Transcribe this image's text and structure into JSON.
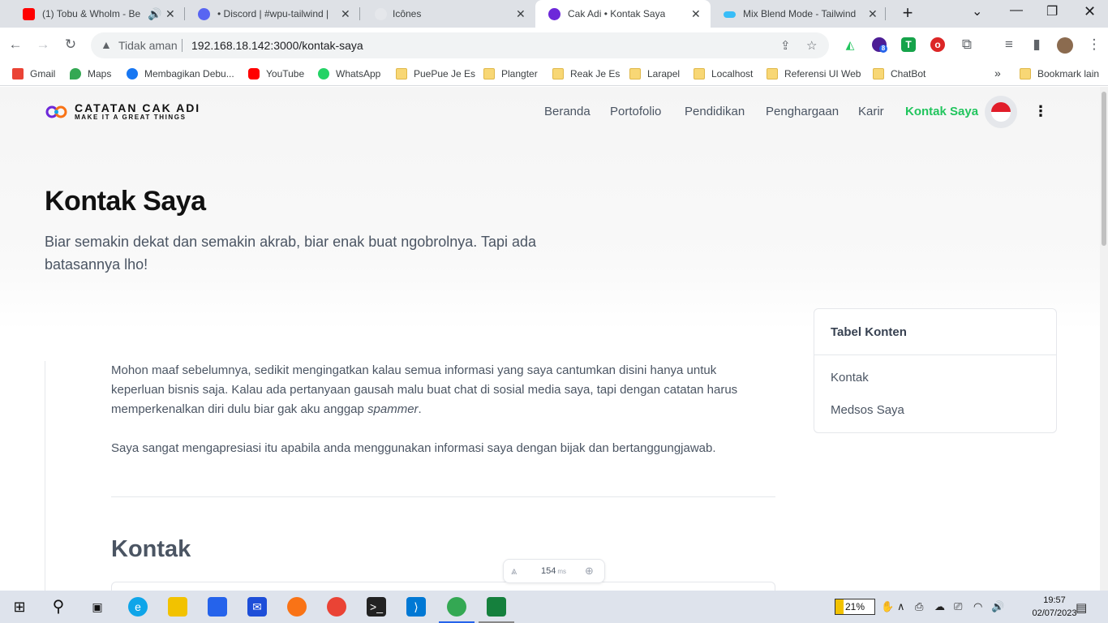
{
  "tabs": [
    {
      "title": "(1) Tobu & Wholm - Be",
      "active": false
    },
    {
      "title": "• Discord | #wpu-tailwind |",
      "active": false
    },
    {
      "title": "Icônes",
      "active": false
    },
    {
      "title": "Cak Adi • Kontak Saya",
      "active": true
    },
    {
      "title": "Mix Blend Mode - Tailwind",
      "active": false
    }
  ],
  "toolbar": {
    "security_label": "Tidak aman",
    "url": "192.168.18.142:3000/kontak-saya",
    "ext_badge": "8"
  },
  "bookmarks": [
    {
      "label": "Gmail"
    },
    {
      "label": "Maps"
    },
    {
      "label": "Membagikan Debu..."
    },
    {
      "label": "YouTube"
    },
    {
      "label": "WhatsApp"
    },
    {
      "label": "PuePue Je Es"
    },
    {
      "label": "Plangter"
    },
    {
      "label": "Reak Je Es"
    },
    {
      "label": "Larapel"
    },
    {
      "label": "Localhost"
    },
    {
      "label": "Referensi UI Web"
    },
    {
      "label": "ChatBot"
    },
    {
      "label": "Bookmark lain"
    }
  ],
  "site": {
    "logo_title": "CATATAN CAK ADI",
    "logo_tagline": "MAKE IT A GREAT THINGS",
    "nav": [
      "Beranda",
      "Portofolio",
      "Pendidikan",
      "Penghargaan",
      "Karir",
      "Kontak Saya"
    ],
    "active_nav": "Kontak Saya",
    "accent": "#22c55e"
  },
  "hero": {
    "title": "Kontak Saya",
    "subtitle": "Biar semakin dekat dan semakin akrab, biar enak buat ngobrolnya. Tapi ada batasannya lho!"
  },
  "article": {
    "para1_a": "Mohon maaf sebelumnya, sedikit mengingatkan kalau semua informasi yang saya cantumkan disini hanya untuk keperluan bisnis saja. Kalau ada pertanyaan gausah malu buat chat di sosial media saya, tapi dengan catatan harus memperkenalkan diri dulu biar gak aku anggap ",
    "para1_em": "spammer",
    "para1_b": ".",
    "para2": "Saya sangat mengapresiasi itu apabila anda menggunakan informasi saya dengan bijak dan bertanggungjawab.",
    "section_heading": "Kontak"
  },
  "toc": {
    "heading": "Tabel Konten",
    "items": [
      "Kontak",
      "Medsos Saya"
    ]
  },
  "perf": {
    "value": "154",
    "unit": "ms"
  },
  "taskbar": {
    "battery": "21%",
    "time": "19:57",
    "date": "02/07/2023"
  }
}
